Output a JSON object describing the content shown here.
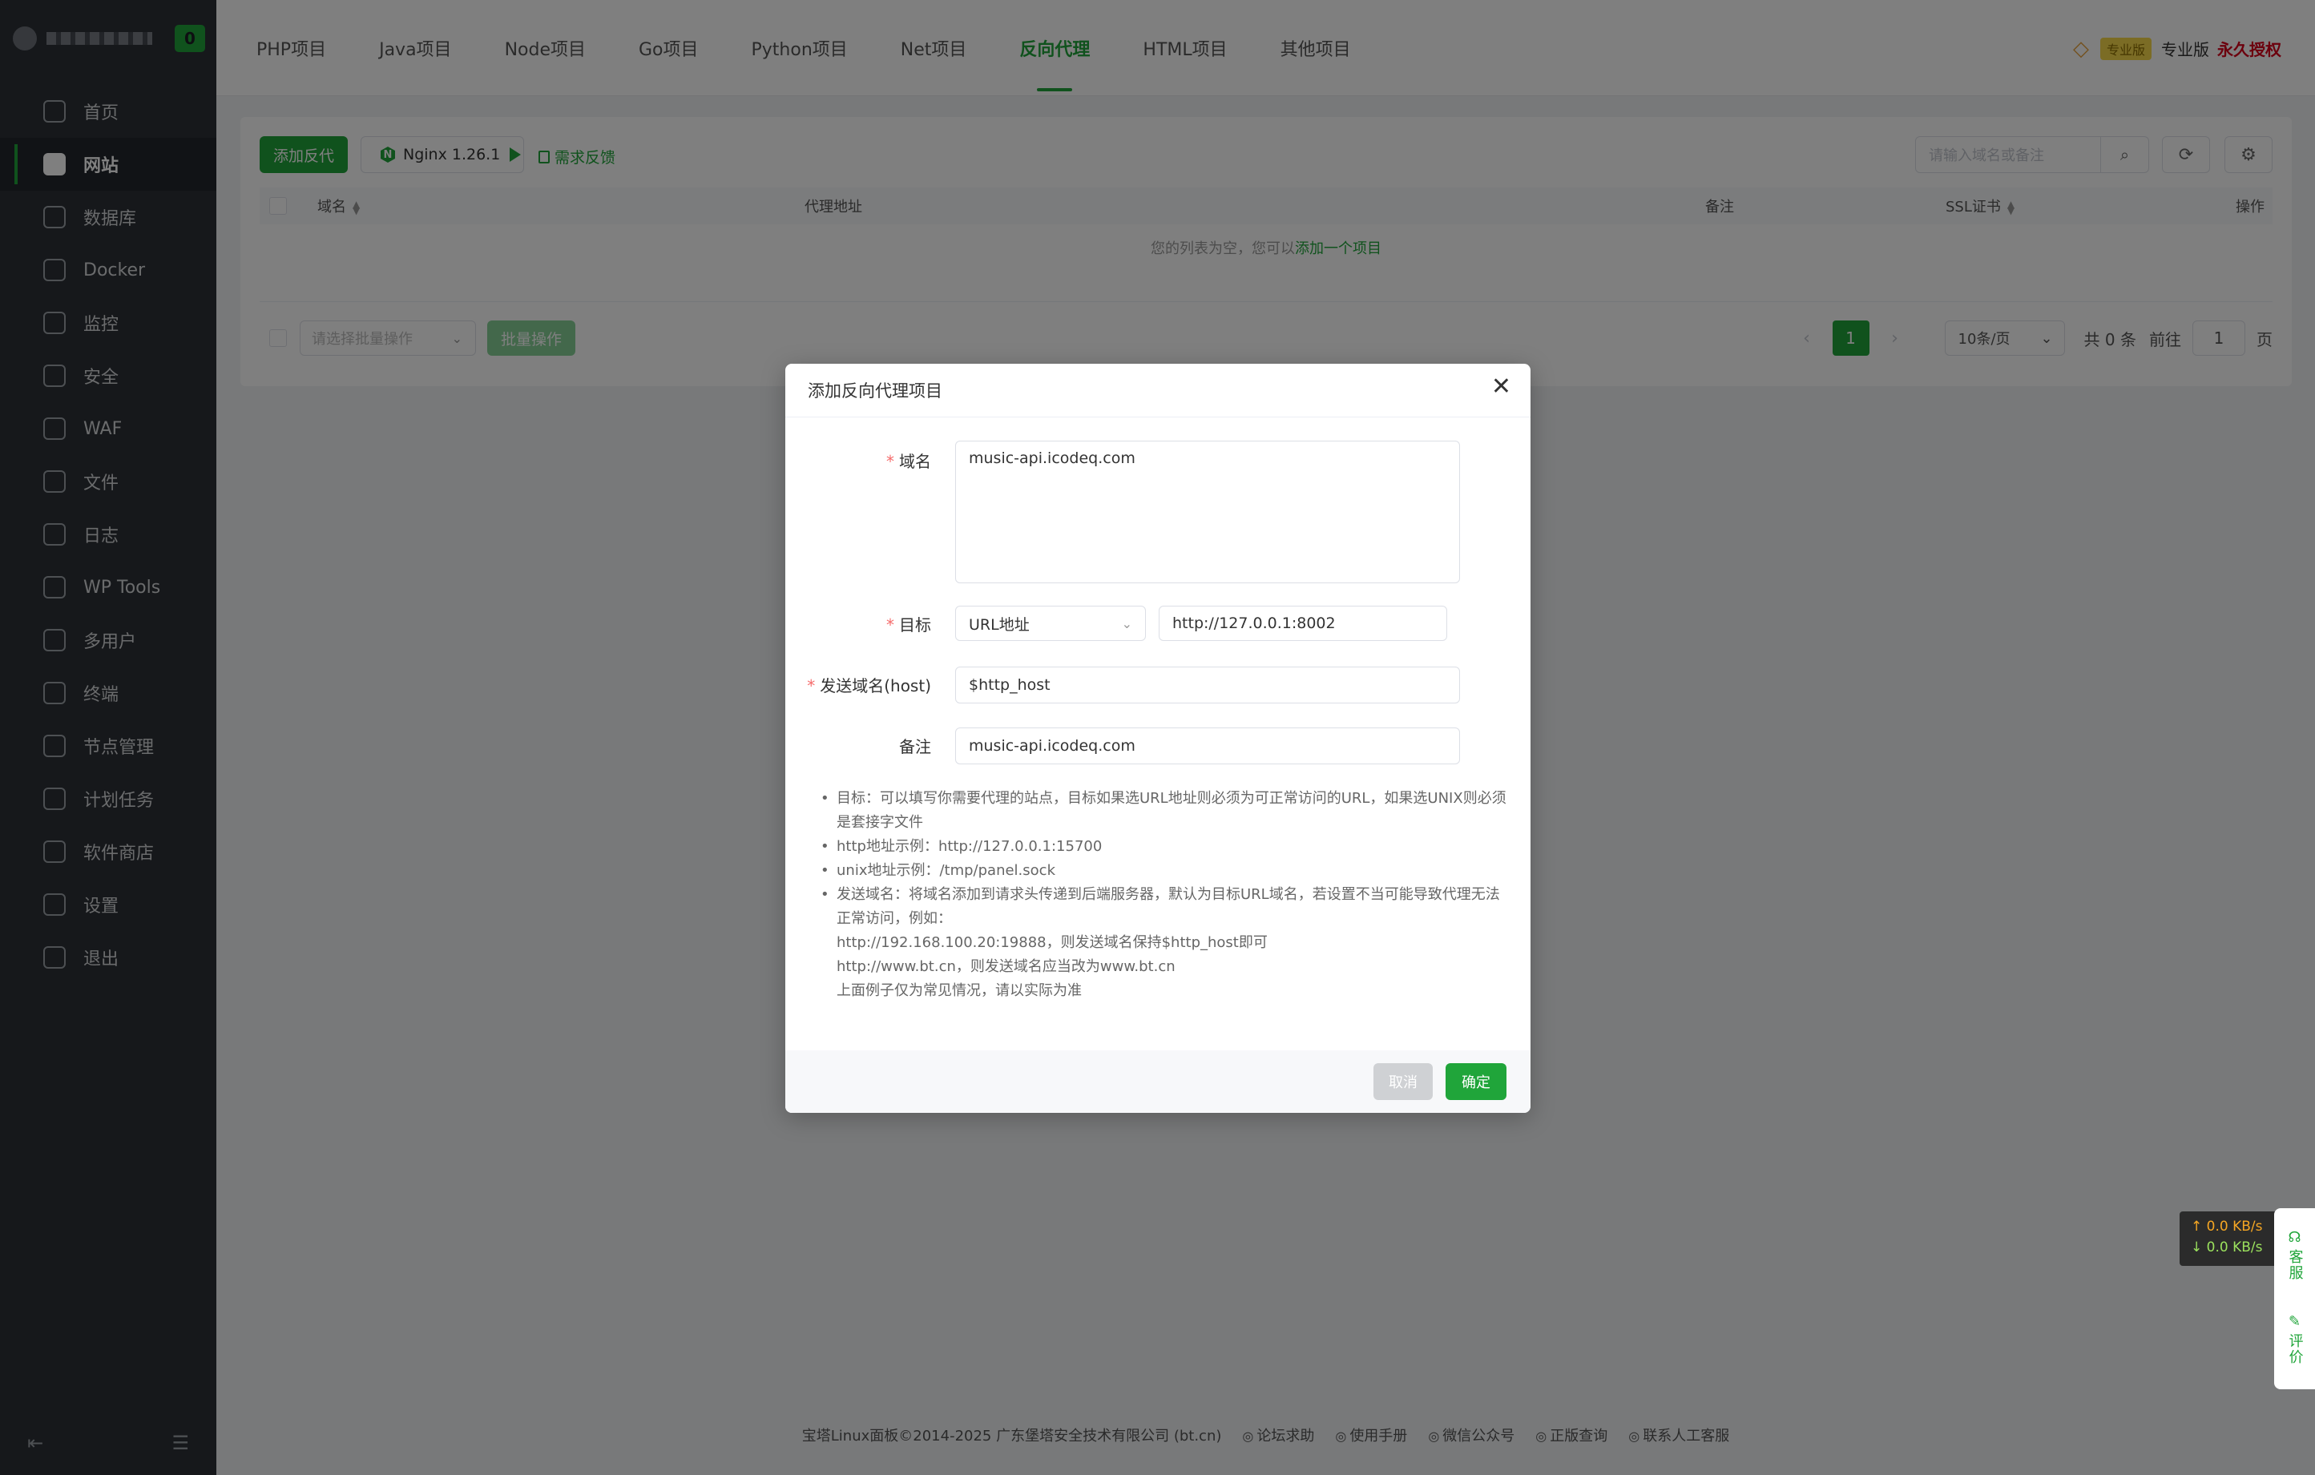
{
  "brand": {
    "badge": "0"
  },
  "sidebar": {
    "items": [
      {
        "label": "首页",
        "icon": "home-icon"
      },
      {
        "label": "网站",
        "icon": "website-icon",
        "active": true
      },
      {
        "label": "数据库",
        "icon": "database-icon"
      },
      {
        "label": "Docker",
        "icon": "docker-icon"
      },
      {
        "label": "监控",
        "icon": "monitor-icon"
      },
      {
        "label": "安全",
        "icon": "shield-icon"
      },
      {
        "label": "WAF",
        "icon": "waf-icon"
      },
      {
        "label": "文件",
        "icon": "folder-icon"
      },
      {
        "label": "日志",
        "icon": "log-icon"
      },
      {
        "label": "WP Tools",
        "icon": "wordpress-icon"
      },
      {
        "label": "多用户",
        "icon": "users-icon"
      },
      {
        "label": "终端",
        "icon": "terminal-icon"
      },
      {
        "label": "节点管理",
        "icon": "node-icon"
      },
      {
        "label": "计划任务",
        "icon": "calendar-icon"
      },
      {
        "label": "软件商店",
        "icon": "store-icon"
      },
      {
        "label": "设置",
        "icon": "gear-icon"
      },
      {
        "label": "退出",
        "icon": "logout-icon"
      }
    ]
  },
  "tabs": [
    {
      "label": "PHP项目"
    },
    {
      "label": "Java项目"
    },
    {
      "label": "Node项目"
    },
    {
      "label": "Go项目"
    },
    {
      "label": "Python项目"
    },
    {
      "label": "Net项目"
    },
    {
      "label": "反向代理",
      "active": true
    },
    {
      "label": "HTML项目"
    },
    {
      "label": "其他项目"
    }
  ],
  "license": {
    "tag": "专业版",
    "type": "专业版",
    "auth": "永久授权"
  },
  "toolbar": {
    "add_label": "添加反代",
    "nginx_label": "Nginx 1.26.1",
    "feedback_label": "需求反馈",
    "search_placeholder": "请输入域名或备注"
  },
  "table": {
    "headers": {
      "domain": "域名",
      "proxy": "代理地址",
      "remark": "备注",
      "ssl": "SSL证书",
      "action": "操作"
    },
    "empty_prefix": "您的列表为空，您可以",
    "empty_link": "添加一个项目"
  },
  "batch": {
    "placeholder": "请选择批量操作",
    "button": "批量操作"
  },
  "pager": {
    "current": "1",
    "page_size": "10条/页",
    "total": "共 0 条",
    "goto_prefix": "前往",
    "goto_value": "1",
    "goto_suffix": "页"
  },
  "footer": {
    "copyright": "宝塔Linux面板©2014-2025 广东堡塔安全技术有限公司 (bt.cn)",
    "links": [
      "论坛求助",
      "使用手册",
      "微信公众号",
      "正版查询",
      "联系人工客服"
    ]
  },
  "speed": {
    "up": "↑ 0.0 KB/s",
    "down": "↓ 0.0 KB/s"
  },
  "float": {
    "service": "客服",
    "review": "评价"
  },
  "dialog": {
    "title": "添加反向代理项目",
    "domain_label": "域名",
    "domain_value": "music-api.icodeq.com",
    "target_label": "目标",
    "target_type": "URL地址",
    "target_value": "http://127.0.0.1:8002",
    "host_label": "发送域名(host)",
    "host_value": "$http_host",
    "remark_label": "备注",
    "remark_value": "music-api.icodeq.com",
    "notes": [
      "目标：可以填写你需要代理的站点，目标如果选URL地址则必须为可正常访问的URL，如果选UNIX则必须是套接字文件",
      "http地址示例：http://127.0.0.1:15700",
      "unix地址示例：/tmp/panel.sock",
      "发送域名：将域名添加到请求头传递到后端服务器，默认为目标URL域名，若设置不当可能导致代理无法正常访问，例如："
    ],
    "note_lines": [
      "http://192.168.100.20:19888，则发送域名保持$http_host即可",
      "http://www.bt.cn，则发送域名应当改为www.bt.cn",
      "上面例子仅为常见情况，请以实际为准"
    ],
    "cancel": "取消",
    "confirm": "确定"
  }
}
